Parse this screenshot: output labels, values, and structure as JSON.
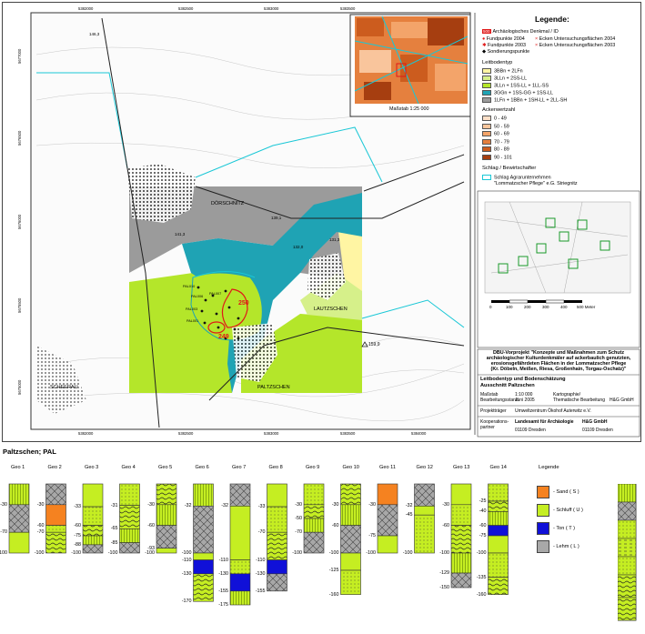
{
  "map": {
    "grid_labels_top": [
      "5382000",
      "5382500",
      "5383000",
      "5383500"
    ],
    "grid_labels_bottom": [
      "5382000",
      "5382500",
      "5383000",
      "5383500",
      "5384000"
    ],
    "grid_labels_left": [
      "5677000",
      "5676500",
      "5676000",
      "5675500",
      "5675000"
    ],
    "places": {
      "doerschnitz": "DÖRSCHNITZ",
      "lautzschen": "LAUTZSCHEN",
      "paltzschen": "PALTZSCHEN",
      "scheerau": "SCHEERAU"
    },
    "elevation_labels": [
      "146,3",
      "141,3",
      "144,3",
      "150,0",
      "139,1",
      "132,0",
      "131,3",
      "159,9",
      "146,2",
      "131,4",
      "122,5",
      "119,2"
    ],
    "monuments": [
      "250",
      "249"
    ],
    "probe_points": [
      "PAL010",
      "PAL006",
      "PAL007",
      "PAL008",
      "PAL003",
      "PAL004",
      "PAL009",
      "PAL005",
      "PAL001",
      "PAL002",
      "PAL011",
      "PAL012",
      "PAL013"
    ]
  },
  "inset": {
    "scale": "Maßstab 1:25 000"
  },
  "legend": {
    "title": "Legende:",
    "symbols": [
      {
        "label": "Archäologisches Denkmal / ID",
        "badge": "500"
      },
      {
        "label": "Fundpunkte 2004"
      },
      {
        "label": "Fundpunkte 2003"
      },
      {
        "label": "Sondierungspunkte"
      }
    ],
    "ecken": [
      {
        "label": "Ecken Untersuchungsflächen 2004"
      },
      {
        "label": "Ecken Untersuchungsflächen 2003"
      }
    ],
    "leitbodentyp_title": "Leitbodentyp",
    "leitbodentyp": [
      {
        "label": "3BBn + 2LFn",
        "color": "#fff5a3"
      },
      {
        "label": "3LLn + 2SS-LL",
        "color": "#d6f08a"
      },
      {
        "label": "3LLn + 1SS-LL + 1LL-SS",
        "color": "#b4e62a"
      },
      {
        "label": "3GGn + 1SS-GG + 1SS-LL",
        "color": "#1fa3b4"
      },
      {
        "label": "1LFn + 1BBn + 1SH-LL + 2LL-SH",
        "color": "#9b9b9b"
      }
    ],
    "ackerwertzahl_title": "Ackerwertzahl",
    "ackerwertzahl": [
      {
        "label": "0 - 49",
        "color": "#fde0c8"
      },
      {
        "label": "50 - 59",
        "color": "#f9c59c"
      },
      {
        "label": "60 - 69",
        "color": "#f3a46a"
      },
      {
        "label": "70 - 79",
        "color": "#e5803e"
      },
      {
        "label": "80 - 89",
        "color": "#cc5c1e"
      },
      {
        "label": "90 - 101",
        "color": "#a63e10"
      }
    ],
    "schlag_title": "Schlag / Bewirtschafter",
    "schlag_line1": "Schlag Agrarunternehmen",
    "schlag_line2": "\"Lommatzscher Pflege\" e.G. Striegnitz",
    "scalebar": [
      "0",
      "100",
      "200",
      "300",
      "400",
      "500 Meter"
    ]
  },
  "project": {
    "title_lines": [
      "DBU-Vorprojekt \"Konzepte und Maßnahmen zum Schutz",
      "archäologischer Kulturdenkmäler auf ackerbaulich genutzten,",
      "erosionsgefährdeten Flächen in der Lommatzscher Pflege",
      "(Kr. Döbeln, Meißen, Riesa, Großenhain, Torgau-Oschatz)\""
    ],
    "subtitle1": "Leitbodentyp und Bodenschätzung",
    "subtitle2": "Ausschnitt Paltzschen",
    "massstab_label": "Maßstab",
    "massstab_value": "1:10 000",
    "bearbeitung_label": "Bearbeitungsstand",
    "bearbeitung_value": "Juni 2005",
    "kartograph_label": "Kartographie/",
    "thematisch_label": "Thematische Bearbeitung",
    "firma": "H&G GmbH",
    "projekttraeger_label": "Projektträger",
    "projekttraeger_value": "Umweltzentrum Ökohof Auterwitz e.V.",
    "kooperation_label": "Kooperations-partner",
    "partner1": "Landesamt für Archäologie",
    "partner1_city": "01109 Dresden",
    "partner2": "H&G GmbH",
    "partner2_city": "01109 Dresden"
  },
  "profiles": {
    "heading": "Paltzschen; PAL",
    "legend_title": "Legende",
    "legend_items": [
      {
        "label": "- Sand ( S )",
        "color": "#f58220"
      },
      {
        "label": "- Schluff ( U )",
        "color": "#c5ee22"
      },
      {
        "label": "- Ton ( T )",
        "color": "#1010d8"
      },
      {
        "label": "- Lehm ( L )",
        "color": "#a8a8a8"
      }
    ],
    "columns": [
      {
        "name": "Geo 1",
        "depths": [
          "-30",
          "-70",
          "-100"
        ]
      },
      {
        "name": "Geo 2",
        "depths": [
          "-30",
          "-60",
          "-70",
          "-100"
        ]
      },
      {
        "name": "Geo 3",
        "depths": [
          "-33",
          "-60",
          "-75",
          "-88",
          "-100"
        ]
      },
      {
        "name": "Geo 4",
        "depths": [
          "-31",
          "-65",
          "-85",
          "-100"
        ]
      },
      {
        "name": "Geo 5",
        "depths": [
          "-30",
          "-60",
          "-93",
          "-100"
        ]
      },
      {
        "name": "Geo 6",
        "depths": [
          "-32",
          "-100",
          "-110",
          "-130",
          "-170"
        ]
      },
      {
        "name": "Geo 7",
        "depths": [
          "-32",
          "-110",
          "-130",
          "-155",
          "-175"
        ]
      },
      {
        "name": "Geo 8",
        "depths": [
          "-33",
          "-70",
          "-110",
          "-130",
          "-155"
        ]
      },
      {
        "name": "Geo 9",
        "depths": [
          "-30",
          "-50",
          "-70",
          "-100"
        ]
      },
      {
        "name": "Geo 10",
        "depths": [
          "-30",
          "-60",
          "-100",
          "-125",
          "-160"
        ]
      },
      {
        "name": "Geo 11",
        "depths": [
          "-30",
          "-75",
          "-100"
        ]
      },
      {
        "name": "Geo 12",
        "depths": [
          "-32",
          "-45",
          "-100"
        ]
      },
      {
        "name": "Geo 13",
        "depths": [
          "-30",
          "-60",
          "-100",
          "-129",
          "-150"
        ]
      },
      {
        "name": "Geo 14",
        "depths": [
          "-25",
          "-40",
          "-60",
          "-75",
          "-100",
          "-135",
          "-160"
        ]
      }
    ]
  }
}
